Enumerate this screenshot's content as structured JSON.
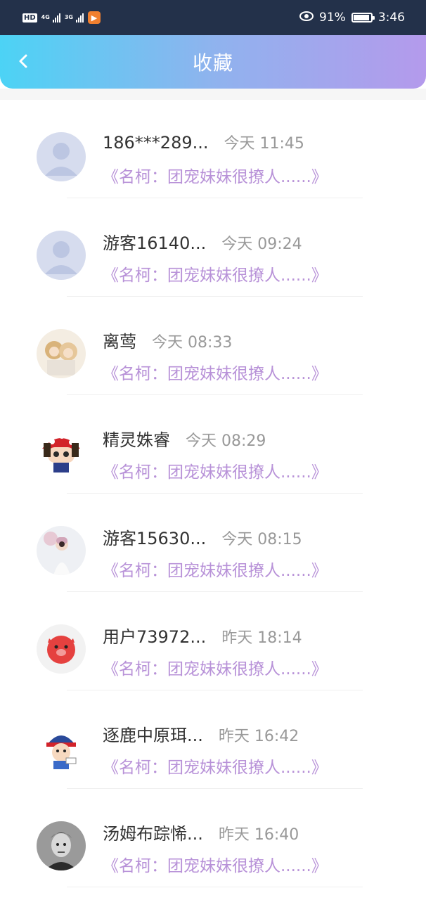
{
  "statusbar": {
    "hd": "HD",
    "net1": "4G",
    "net2": "3G",
    "battery": "91%",
    "time": "3:46",
    "battery_level": 0.91
  },
  "header": {
    "back_icon": "chevron-left-icon",
    "title": "收藏"
  },
  "items": [
    {
      "name": "186***289...",
      "time": "今天 11:45",
      "link": "《名柯：团宠妹妹很撩人......》",
      "avatar": "default-person"
    },
    {
      "name": "游客16140...",
      "time": "今天 09:24",
      "link": "《名柯：团宠妹妹很撩人......》",
      "avatar": "default-person"
    },
    {
      "name": "离莺",
      "time": "今天 08:33",
      "link": "《名柯：团宠妹妹很撩人......》",
      "avatar": "anime-couple"
    },
    {
      "name": "精灵姝睿",
      "time": "今天 08:29",
      "link": "《名柯：团宠妹妹很撩人......》",
      "avatar": "mushroom-cartoon"
    },
    {
      "name": "游客15630...",
      "time": "今天 08:15",
      "link": "《名柯：团宠妹妹很撩人......》",
      "avatar": "girl-snow-photo"
    },
    {
      "name": "用户73972...",
      "time": "昨天 18:14",
      "link": "《名柯：团宠妹妹很撩人......》",
      "avatar": "red-pig"
    },
    {
      "name": "逐鹿中原珥...",
      "time": "昨天 16:42",
      "link": "《名柯：团宠妹妹很撩人......》",
      "avatar": "cartoon-boy"
    },
    {
      "name": "汤姆布踪悕...",
      "time": "昨天 16:40",
      "link": "《名柯：团宠妹妹很撩人......》",
      "avatar": "bw-man-photo"
    }
  ]
}
